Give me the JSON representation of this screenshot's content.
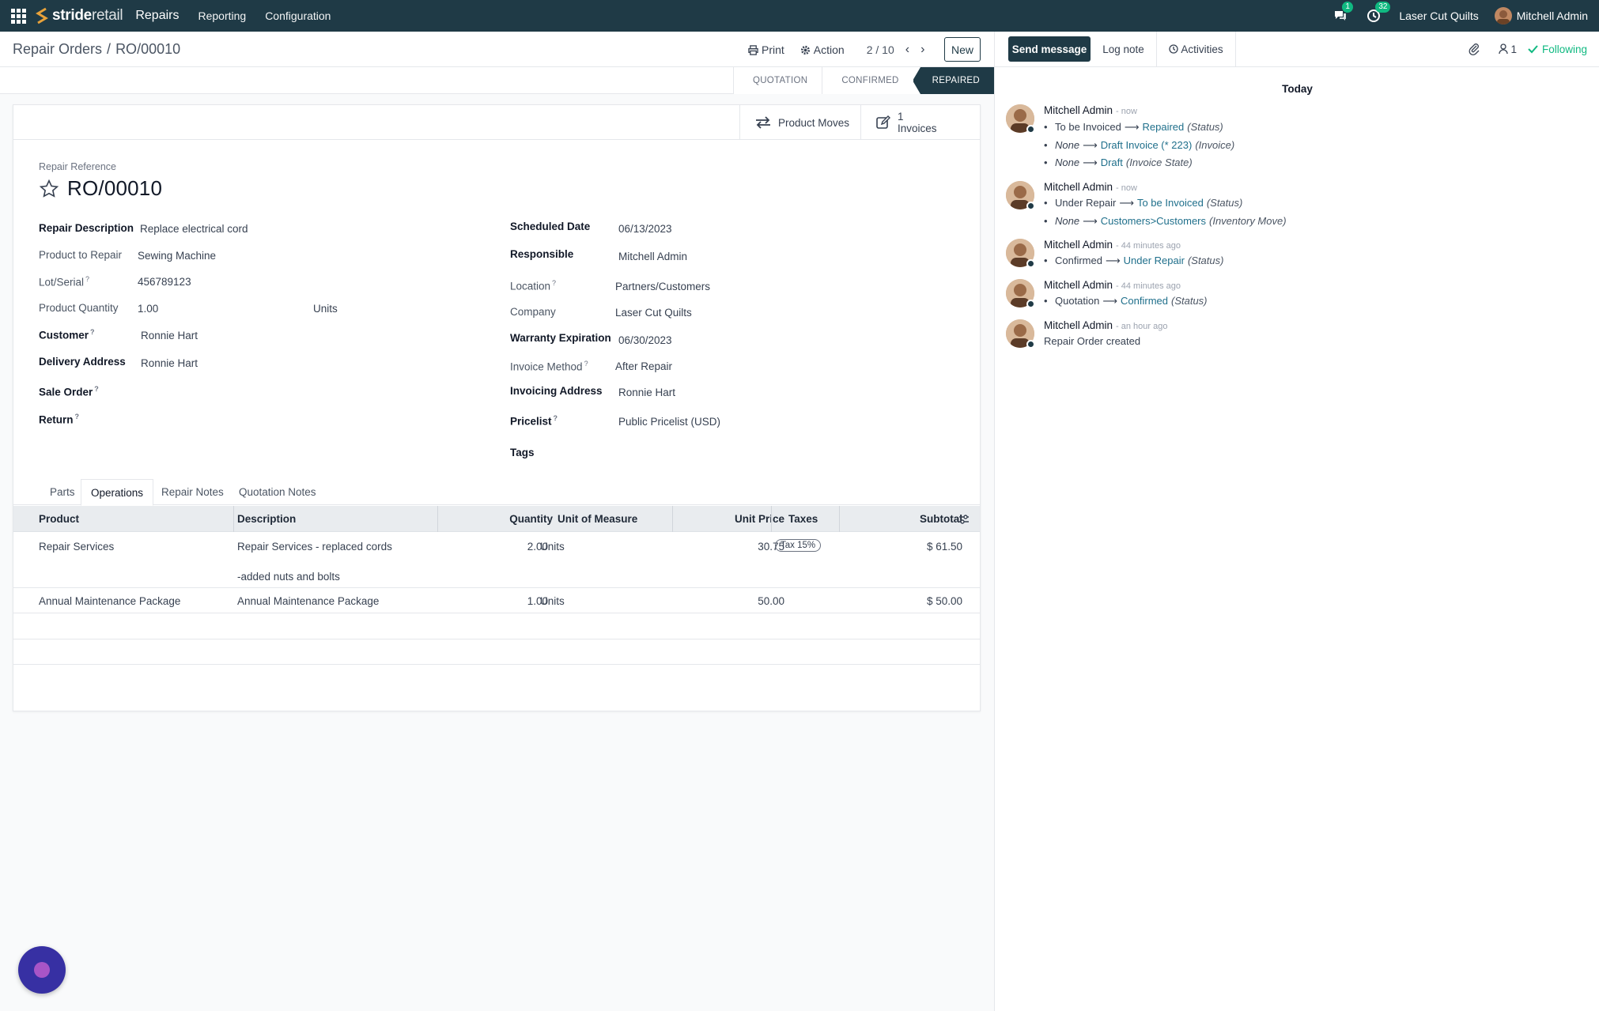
{
  "topbar": {
    "brand_bold": "stride",
    "brand_light": "retail",
    "app": "Repairs",
    "menus": [
      "Reporting",
      "Configuration"
    ],
    "messages_count": "1",
    "activities_count": "32",
    "company": "Laser Cut Quilts",
    "user": "Mitchell Admin"
  },
  "control_panel": {
    "breadcrumb_parent": "Repair Orders",
    "breadcrumb_separator": "/",
    "breadcrumb_current": "RO/00010",
    "print_label": "Print",
    "action_label": "Action",
    "pager": "2 / 10",
    "new_label": "New"
  },
  "statusbar": {
    "stages": [
      "QUOTATION",
      "CONFIRMED",
      "REPAIRED"
    ],
    "active_stage": "REPAIRED"
  },
  "smart_buttons": {
    "product_moves": "Product Moves",
    "invoices_count": "1",
    "invoices_label": "Invoices"
  },
  "form": {
    "ref_label": "Repair Reference",
    "ref_value": "RO/00010",
    "left": [
      {
        "label": "Repair Description",
        "value": "Replace electrical cord",
        "bold": true,
        "help": false
      },
      {
        "label": "Product to Repair",
        "value": "Sewing Machine",
        "bold": false,
        "help": false
      },
      {
        "label": "Lot/Serial",
        "value": "456789123",
        "bold": false,
        "help": true
      },
      {
        "label": "Product Quantity",
        "value": "1.00",
        "unit": "Units",
        "bold": false,
        "help": false
      },
      {
        "label": "Customer",
        "value": "Ronnie Hart",
        "bold": true,
        "help": true
      },
      {
        "label": "Delivery Address",
        "value": "Ronnie Hart",
        "bold": true,
        "help": false
      },
      {
        "label": "Sale Order",
        "value": "",
        "bold": true,
        "help": true
      },
      {
        "label": "Return",
        "value": "",
        "bold": true,
        "help": true
      }
    ],
    "right": [
      {
        "label": "Scheduled Date",
        "value": "06/13/2023",
        "bold": true,
        "help": false
      },
      {
        "label": "Responsible",
        "value": "Mitchell Admin",
        "bold": true,
        "help": false
      },
      {
        "label": "Location",
        "value": "Partners/Customers",
        "bold": false,
        "help": true
      },
      {
        "label": "Company",
        "value": "Laser Cut Quilts",
        "bold": false,
        "help": false
      },
      {
        "label": "Warranty Expiration",
        "value": "06/30/2023",
        "bold": true,
        "help": false
      },
      {
        "label": "Invoice Method",
        "value": "After Repair",
        "bold": false,
        "help": true
      },
      {
        "label": "Invoicing Address",
        "value": "Ronnie Hart",
        "bold": true,
        "help": false
      },
      {
        "label": "Pricelist",
        "value": "Public Pricelist (USD)",
        "bold": true,
        "help": true
      },
      {
        "label": "Tags",
        "value": "",
        "bold": true,
        "help": false
      }
    ]
  },
  "tabs": [
    "Parts",
    "Operations",
    "Repair Notes",
    "Quotation Notes"
  ],
  "active_tab": "Operations",
  "table": {
    "headers": [
      "Product",
      "Description",
      "Quantity",
      "Unit of Measure",
      "Unit Price",
      "Taxes",
      "Subtotal"
    ],
    "rows": [
      {
        "product": "Repair Services",
        "description": "Repair Services - replaced cords",
        "description2": "-added nuts and bolts",
        "quantity": "2.00",
        "uom": "Units",
        "unit_price": "30.75",
        "taxes": "Tax 15%",
        "subtotal": "$ 61.50"
      },
      {
        "product": "Annual Maintenance Package",
        "description": "Annual Maintenance Package",
        "description2": "",
        "quantity": "1.00",
        "uom": "Units",
        "unit_price": "50.00",
        "taxes": "",
        "subtotal": "$ 50.00"
      }
    ]
  },
  "chatter": {
    "send_message": "Send message",
    "log_note": "Log note",
    "activities": "Activities",
    "followers_count": "1",
    "following": "Following",
    "today": "Today",
    "messages": [
      {
        "author": "Mitchell Admin",
        "when": "- now",
        "changes": [
          {
            "old": "To be Invoiced",
            "old_none": false,
            "new": "Repaired",
            "field": "(Status)"
          },
          {
            "old": "None",
            "old_none": true,
            "new": "Draft Invoice (* 223)",
            "field": "(Invoice)"
          },
          {
            "old": "None",
            "old_none": true,
            "new": "Draft",
            "field": "(Invoice State)"
          }
        ]
      },
      {
        "author": "Mitchell Admin",
        "when": "- now",
        "changes": [
          {
            "old": "Under Repair",
            "old_none": false,
            "new": "To be Invoiced",
            "field": "(Status)"
          },
          {
            "old": "None",
            "old_none": true,
            "new": "Customers>Customers",
            "field": "(Inventory Move)"
          }
        ]
      },
      {
        "author": "Mitchell Admin",
        "when": "- 44 minutes ago",
        "changes": [
          {
            "old": "Confirmed",
            "old_none": false,
            "new": "Under Repair",
            "field": "(Status)"
          }
        ]
      },
      {
        "author": "Mitchell Admin",
        "when": "- 44 minutes ago",
        "changes": [
          {
            "old": "Quotation",
            "old_none": false,
            "new": "Confirmed",
            "field": "(Status)"
          }
        ]
      },
      {
        "author": "Mitchell Admin",
        "when": "- an hour ago",
        "body": "Repair Order created"
      }
    ]
  },
  "colors": {
    "topbar": "#1f3a46",
    "accent_link": "#1f6f8b",
    "following": "#10b981",
    "fab": "#3730a3"
  }
}
